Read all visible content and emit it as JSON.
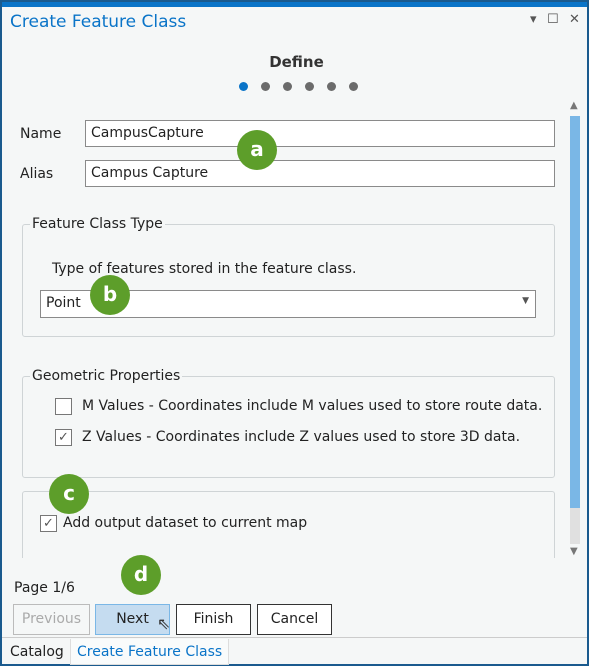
{
  "window": {
    "title": "Create Feature Class",
    "controls": {
      "dropdown": "▾",
      "maximize": "☐",
      "close": "✕"
    }
  },
  "wizard": {
    "step_title": "Define",
    "current_step": 1,
    "total_steps": 6,
    "page_label": "Page 1/6"
  },
  "fields": {
    "name": {
      "label": "Name",
      "value": "CampusCapture"
    },
    "alias": {
      "label": "Alias",
      "value": "Campus Capture"
    }
  },
  "feature_class_type": {
    "legend": "Feature Class Type",
    "description": "Type of features stored in the feature class.",
    "selected": "Point"
  },
  "geometric_properties": {
    "legend": "Geometric Properties",
    "m_values": {
      "label": "M Values - Coordinates include M values used to store route data.",
      "checked": false
    },
    "z_values": {
      "label": "Z Values - Coordinates include Z values used to store 3D data.",
      "checked": true
    }
  },
  "add_output": {
    "label": "Add output dataset to current map",
    "checked": true
  },
  "buttons": {
    "previous": "Previous",
    "next": "Next",
    "finish": "Finish",
    "cancel": "Cancel"
  },
  "tabs": [
    {
      "label": "Catalog",
      "active": false
    },
    {
      "label": "Create Feature Class",
      "active": true
    }
  ],
  "callouts": [
    "a",
    "b",
    "c",
    "d"
  ],
  "colors": {
    "accent": "#0a74c8",
    "callout": "#5d9e2a",
    "scroll_thumb": "#7ab7e6"
  }
}
